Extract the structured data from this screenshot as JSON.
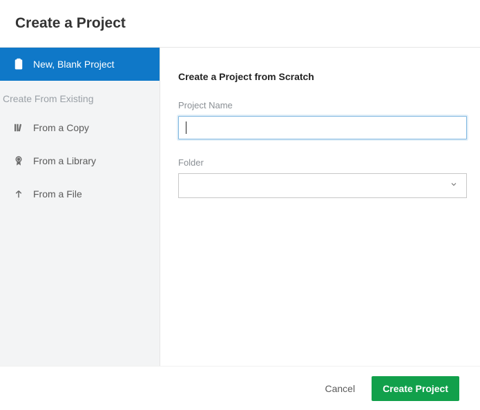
{
  "header": {
    "title": "Create a Project"
  },
  "sidebar": {
    "primary": {
      "label": "New, Blank Project"
    },
    "section_label": "Create From Existing",
    "items": [
      {
        "label": "From a Copy"
      },
      {
        "label": "From a Library"
      },
      {
        "label": "From a File"
      }
    ]
  },
  "content": {
    "title": "Create a Project from Scratch",
    "project_name_label": "Project Name",
    "project_name_value": "",
    "folder_label": "Folder",
    "folder_value": ""
  },
  "footer": {
    "cancel_label": "Cancel",
    "create_label": "Create Project"
  }
}
